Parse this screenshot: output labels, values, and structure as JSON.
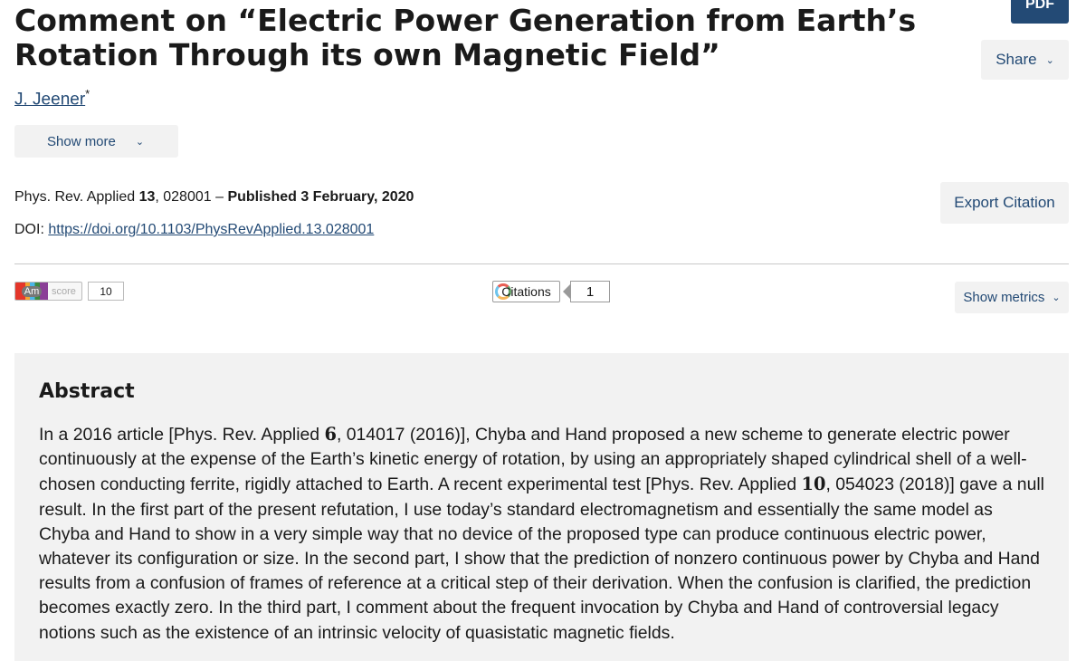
{
  "header": {
    "pdf_label": "PDF",
    "title": "Comment on “Electric Power Generation from Earth’s Rotation Through its own Magnetic Field”",
    "share_label": "Share"
  },
  "authors": {
    "name": "J. Jeener",
    "marker": "*",
    "show_more_label": "Show more"
  },
  "publication": {
    "journal": "Phys. Rev. Applied",
    "volume": "13",
    "article": ", 028001 –",
    "published": "Published 3 February, 2020",
    "doi_label": "DOI:",
    "doi_url": "https://doi.org/10.1103/PhysRevApplied.13.028001",
    "export_label": "Export Citation"
  },
  "metrics": {
    "altmetric_am": "Am",
    "altmetric_score_label": "score",
    "altmetric_score": "10",
    "citations_label": "Citations",
    "citations_count": "1",
    "show_metrics_label": "Show metrics"
  },
  "abstract": {
    "heading": "Abstract",
    "t1": "In a 2016 article [Phys. Rev. Applied ",
    "v1": "6",
    "t2": ", 014017 (2016)], Chyba and Hand proposed a new scheme to generate electric power continuously at the expense of the Earth’s kinetic energy of rotation, by using an appropriately shaped cylindrical shell of a well-chosen conducting ferrite, rigidly attached to Earth. A recent experimental test [Phys. Rev. Applied ",
    "v2": "10",
    "t3": ", 054023 (2018)] gave a null result. In the first part of the present refutation, I use today’s standard electromagnetism and essentially the same model as Chyba and Hand to show in a very simple way that no device of the proposed type can produce continuous electric power, whatever its configuration or size. In the second part, I show that the prediction of nonzero continuous power by Chyba and Hand results from a confusion of frames of reference at a critical step of their derivation. When the confusion is clarified, the prediction becomes exactly zero. In the third part, I comment about the frequent invocation by Chyba and Hand of controversial legacy notions such as the existence of an intrinsic velocity of quasistatic magnetic fields."
  },
  "colors": {
    "accent": "#234a75",
    "button_bg": "#f2f2f2",
    "abstract_bg": "#f2f2f2"
  }
}
